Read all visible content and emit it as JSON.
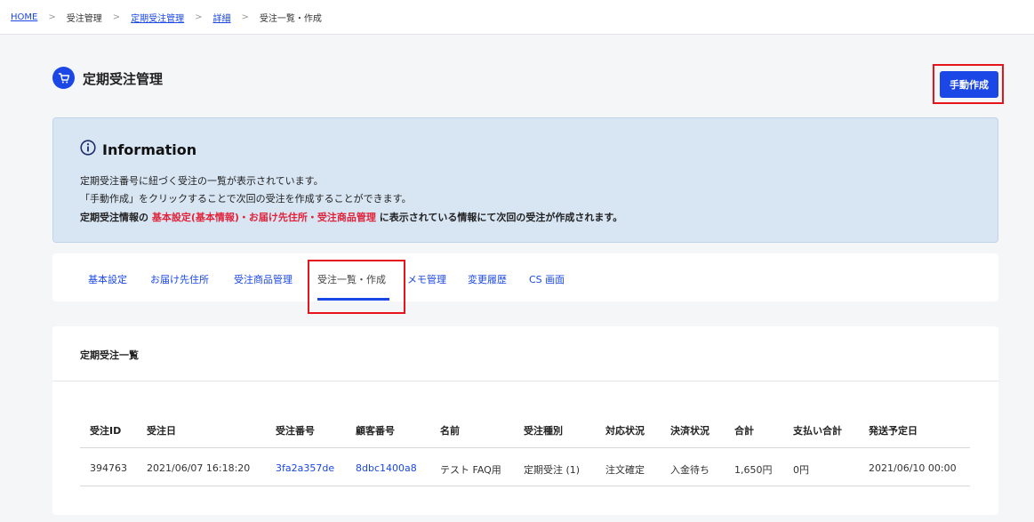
{
  "breadcrumb": {
    "home": "HOME",
    "sep": ">",
    "item1": "受注管理",
    "item2": "定期受注管理",
    "item3": "詳細",
    "item4": "受注一覧・作成"
  },
  "header": {
    "title": "定期受注管理",
    "icon": "cart-icon",
    "manual_create_label": "手動作成"
  },
  "info": {
    "title": "Information",
    "icon": "info-icon",
    "line1": "定期受注番号に紐づく受注の一覧が表示されています。",
    "line2": "「手動作成」をクリックすることで次回の受注を作成することができます。",
    "line3_prefix": "定期受注情報の ",
    "line3_highlight": "基本設定(基本情報)・お届け先住所・受注商品管理",
    "line3_suffix": " に表示されている情報にて次回の受注が作成されます。"
  },
  "tabs": [
    {
      "label": "基本設定"
    },
    {
      "label": "お届け先住所"
    },
    {
      "label": "受注商品管理"
    },
    {
      "label": "受注一覧・作成"
    },
    {
      "label": "メモ管理"
    },
    {
      "label": "変更履歴"
    },
    {
      "label": "CS 画面"
    }
  ],
  "active_tab": "受注一覧・作成",
  "table": {
    "title": "定期受注一覧",
    "columns": [
      "受注ID",
      "受注日",
      "受注番号",
      "顧客番号",
      "名前",
      "受注種別",
      "対応状況",
      "決済状況",
      "合計",
      "支払い合計",
      "発送予定日"
    ],
    "rows": [
      [
        "394763",
        "2021/06/07 16:18:20",
        "3fa2a357de",
        "8dbc1400a8",
        "テスト FAQ用",
        "定期受注 (1)",
        "注文確定",
        "入金待ち",
        "1,650円",
        "0円",
        "2021/06/10 00:00"
      ]
    ]
  },
  "colors": {
    "accent": "#1a47e6",
    "highlight_outline": "#e8141b",
    "info_bg": "#d8e6f4",
    "emphasis_red": "#e0223a"
  }
}
